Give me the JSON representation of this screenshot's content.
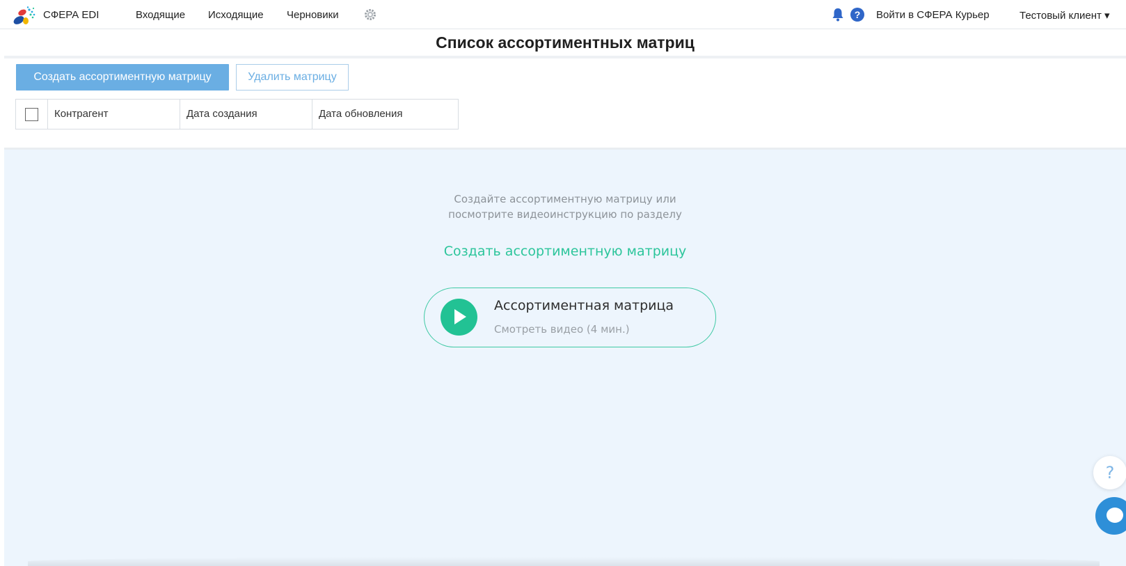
{
  "header": {
    "brand": "СФЕРА EDI",
    "nav": [
      "Входящие",
      "Исходящие",
      "Черновики"
    ],
    "courier_link": "Войти в СФЕРА Курьер",
    "client_menu": "Тестовый клиент ▾",
    "help_glyph": "?"
  },
  "page": {
    "title": "Список ассортиментных матриц"
  },
  "toolbar": {
    "create_label": "Создать ассортиментную матрицу",
    "delete_label": "Удалить матрицу"
  },
  "table": {
    "columns": [
      "Контрагент",
      "Дата создания",
      "Дата обновления"
    ]
  },
  "empty_state": {
    "line1": "Создайте ассортиментную матрицу или",
    "line2": "посмотрите видеоинструкцию по разделу",
    "create_link": "Создать ассортиментную матрицу",
    "video_title": "Ассортиментная матрица",
    "video_subtitle": "Смотреть видео (4 мин.)"
  },
  "widgets": {
    "help_glyph": "?"
  },
  "colors": {
    "accent_blue": "#6aaee3",
    "accent_green": "#22c294",
    "empty_bg": "#edf5fd",
    "chat_blue": "#2e8fd8"
  }
}
